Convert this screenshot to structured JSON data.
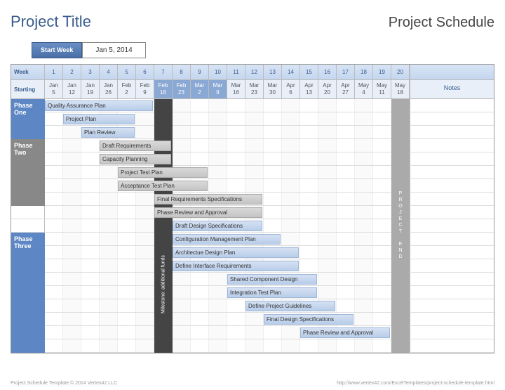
{
  "title": "Project Title",
  "schedule_label": "Project Schedule",
  "start_week_label": "Start Week",
  "start_week_value": "Jan 5, 2014",
  "header": {
    "week_label": "Week",
    "starting_label": "Starting",
    "notes_label": "Notes",
    "weeks": [
      "1",
      "2",
      "3",
      "4",
      "5",
      "6",
      "7",
      "8",
      "9",
      "10",
      "11",
      "12",
      "13",
      "14",
      "15",
      "16",
      "17",
      "18",
      "19",
      "20"
    ],
    "dates": [
      "Jan 5",
      "Jan 12",
      "Jan 19",
      "Jan 26",
      "Feb 2",
      "Feb 9",
      "Feb 16",
      "Feb 23",
      "Mar 2",
      "Mar 9",
      "Mar 16",
      "Mar 23",
      "Mar 30",
      "Apr 6",
      "Apr 13",
      "Apr 20",
      "Apr 27",
      "May 4",
      "May 11",
      "May 18"
    ]
  },
  "phases": {
    "one": "Phase One",
    "two": "Phase Two",
    "three": "Phase Three"
  },
  "milestone_label": "Milestone: additional funds",
  "project_end_label": "PROJECT END",
  "footer_left": "Project Schedule Template © 2014 Vertex42 LLC",
  "footer_right": "http://www.vertex42.com/ExcelTemplates/project-schedule-template.html",
  "chart_data": {
    "type": "bar",
    "title": "Project Schedule",
    "xlabel": "Week",
    "ylabel": "",
    "categories": [
      "1",
      "2",
      "3",
      "4",
      "5",
      "6",
      "7",
      "8",
      "9",
      "10",
      "11",
      "12",
      "13",
      "14",
      "15",
      "16",
      "17",
      "18",
      "19",
      "20"
    ],
    "tasks": [
      {
        "name": "Quality Assurance Plan",
        "phase": "One",
        "start": 1,
        "duration": 6,
        "style": "blue"
      },
      {
        "name": "Project Plan",
        "phase": "One",
        "start": 2,
        "duration": 4,
        "style": "blue"
      },
      {
        "name": "Plan Review",
        "phase": "One",
        "start": 3,
        "duration": 3,
        "style": "blue"
      },
      {
        "name": "Draft Requirements",
        "phase": "Two",
        "start": 4,
        "duration": 4,
        "style": "gray"
      },
      {
        "name": "Capacity Planning",
        "phase": "Two",
        "start": 4,
        "duration": 4,
        "style": "gray"
      },
      {
        "name": "Project Test Plan",
        "phase": "Two",
        "start": 5,
        "duration": 5,
        "style": "gray"
      },
      {
        "name": "Acceptance Test Plan",
        "phase": "Two",
        "start": 5,
        "duration": 5,
        "style": "gray"
      },
      {
        "name": "Final Requirements Specifications",
        "phase": "Two",
        "start": 7,
        "duration": 6,
        "style": "gray"
      },
      {
        "name": "Phase Review and Approval",
        "phase": "Two",
        "start": 7,
        "duration": 6,
        "style": "gray"
      },
      {
        "name": "Draft Design Specifications",
        "phase": "Three",
        "start": 8,
        "duration": 5,
        "style": "blue"
      },
      {
        "name": "Configuration Management Plan",
        "phase": "Three",
        "start": 8,
        "duration": 6,
        "style": "blue"
      },
      {
        "name": "Architectue Design Plan",
        "phase": "Three",
        "start": 8,
        "duration": 7,
        "style": "blue"
      },
      {
        "name": "Define Interface Requirements",
        "phase": "Three",
        "start": 8,
        "duration": 7,
        "style": "blue"
      },
      {
        "name": "Shared Component Design",
        "phase": "Three",
        "start": 11,
        "duration": 5,
        "style": "blue"
      },
      {
        "name": "Integration Test Plan",
        "phase": "Three",
        "start": 11,
        "duration": 5,
        "style": "blue"
      },
      {
        "name": "Define Project Guidelines",
        "phase": "Three",
        "start": 12,
        "duration": 5,
        "style": "blue"
      },
      {
        "name": "Final Design Specifications",
        "phase": "Three",
        "start": 13,
        "duration": 5,
        "style": "blue"
      },
      {
        "name": "Phase Review and Approval",
        "phase": "Three",
        "start": 15,
        "duration": 5,
        "style": "blue"
      }
    ],
    "milestones": [
      {
        "name": "Milestone: additional funds",
        "week": 7
      },
      {
        "name": "PROJECT END",
        "week": 20
      }
    ]
  }
}
